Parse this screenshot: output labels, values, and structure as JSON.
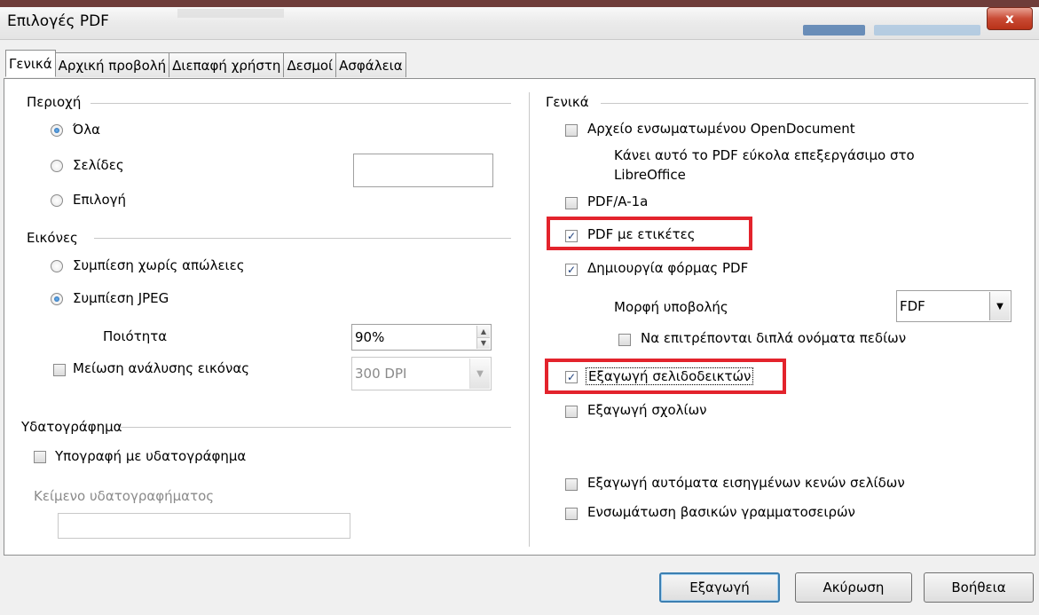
{
  "window": {
    "title": "Επιλογές PDF",
    "close_label": "x"
  },
  "tabs": [
    "Γενικά",
    "Αρχική προβολή",
    "Διεπαφή χρήστη",
    "Δεσμοί",
    "Ασφάλεια"
  ],
  "left": {
    "range": {
      "title": "Περιοχή",
      "all": "Όλα",
      "pages": "Σελίδες",
      "pages_value": "",
      "selection": "Επιλογή",
      "selected": "all"
    },
    "images": {
      "title": "Εικόνες",
      "lossless": "Συμπίεση χωρίς απώλειες",
      "jpeg": "Συμπίεση JPEG",
      "selected": "jpeg",
      "quality_label": "Ποιότητα",
      "quality_value": "90%",
      "reduce_label": "Μείωση ανάλυσης εικόνας",
      "reduce_checked": false,
      "dpi_value": "300 DPI"
    },
    "watermark": {
      "title": "Υδατογράφημα",
      "sign_label": "Υπογραφή με υδατογράφημα",
      "sign_checked": false,
      "text_label": "Κείμενο υδατογραφήματος",
      "text_value": ""
    }
  },
  "right": {
    "title": "Γενικά",
    "embed_odf": {
      "label": "Αρχείο ενσωματωμένου OpenDocument",
      "checked": false
    },
    "embed_note_line1": "Κάνει αυτό το PDF εύκολα επεξεργάσιμο στο",
    "embed_note_line2": "LibreOffice",
    "pdfa": {
      "label": "PDF/A-1a",
      "checked": false
    },
    "tagged": {
      "label": "PDF με ετικέτες",
      "checked": true
    },
    "create_form": {
      "label": "Δημιουργία φόρμας PDF",
      "checked": true
    },
    "submit_format_label": "Μορφή υποβολής",
    "submit_format_value": "FDF",
    "dup_fields": {
      "label": "Να επιτρέπονται διπλά ονόματα πεδίων",
      "checked": false
    },
    "bookmarks": {
      "label": "Εξαγωγή σελιδοδεικτών",
      "checked": true
    },
    "comments": {
      "label": "Εξαγωγή σχολίων",
      "checked": false
    },
    "auto_blank": {
      "label": "Εξαγωγή αυτόματα εισηγμένων κενών σελίδων",
      "checked": false
    },
    "embed_fonts": {
      "label": "Ενσωμάτωση βασικών γραμματοσειρών",
      "checked": false
    }
  },
  "buttons": {
    "export": "Εξαγωγή",
    "cancel": "Ακύρωση",
    "help": "Βοήθεια"
  },
  "colors": {
    "highlight": "#e3232c",
    "close_button": "#c94a34",
    "default_button_border": "#3c7fb1"
  },
  "icons": {
    "checkmark": "✓",
    "spin_up": "▲",
    "spin_down": "▼",
    "dropdown": "▼"
  }
}
